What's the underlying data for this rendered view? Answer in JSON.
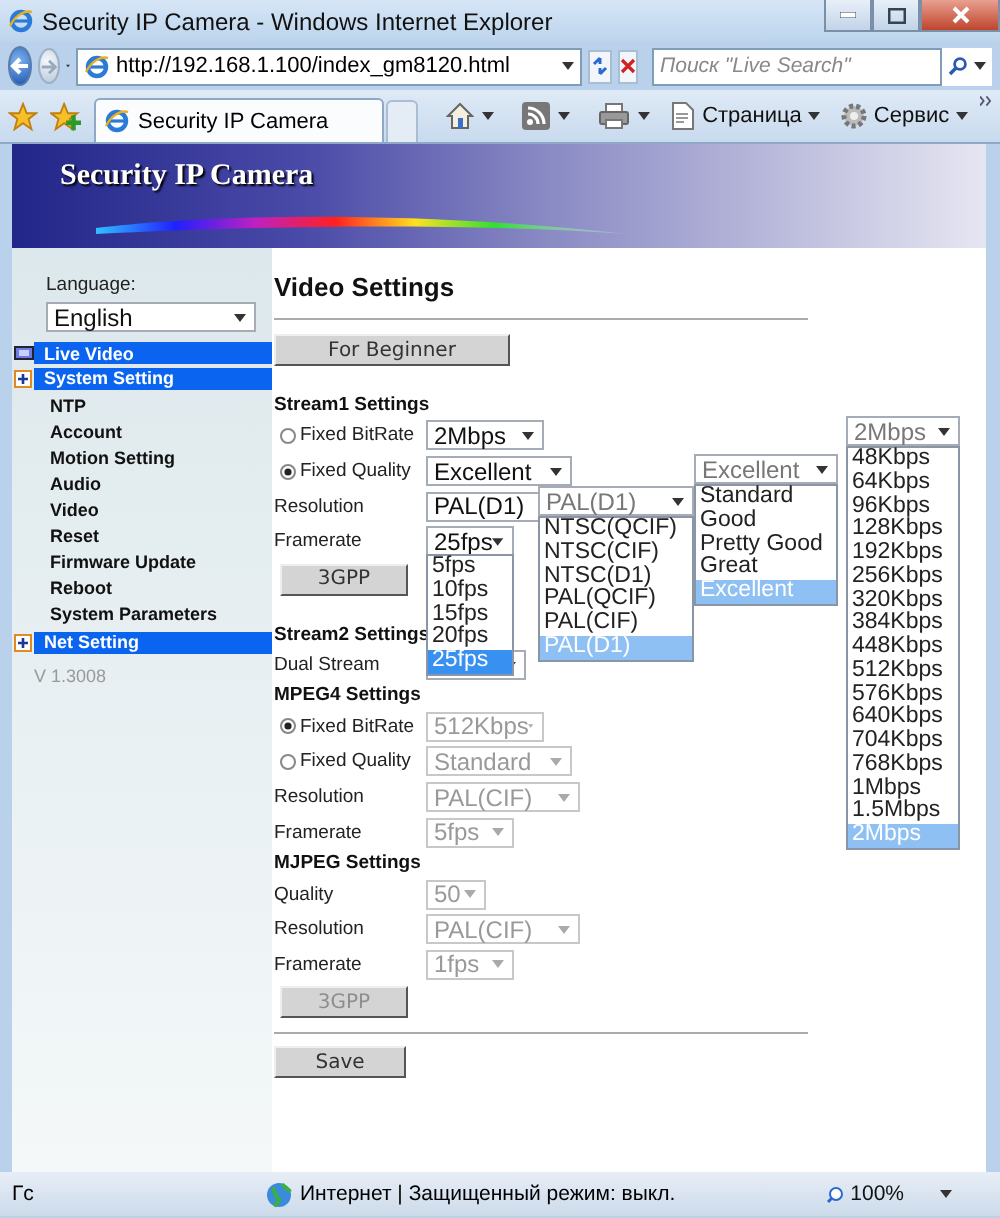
{
  "window": {
    "title": "Security IP Camera - Windows Internet Explorer"
  },
  "address_bar": {
    "url": "http://192.168.1.100/index_gm8120.html",
    "search_placeholder": "Поиск \"Live Search\""
  },
  "tabs": [
    {
      "label": "Security IP Camera",
      "selected": true
    }
  ],
  "toolbar": [
    {
      "label": "Страница",
      "kind": "page"
    },
    {
      "label": "Сервис",
      "kind": "tools"
    }
  ],
  "banner": {
    "title": "Security IP Camera"
  },
  "sidebar": {
    "language_label": "Language:",
    "language": "English",
    "items": [
      {
        "label": "Live Video",
        "kind": "video"
      },
      {
        "label": "System Setting",
        "kind": "group",
        "children": [
          {
            "label": "NTP"
          },
          {
            "label": "Account"
          },
          {
            "label": "Motion Setting"
          },
          {
            "label": "Audio"
          },
          {
            "label": "Video"
          },
          {
            "label": "Reset"
          },
          {
            "label": "Firmware Update"
          },
          {
            "label": "Reboot"
          },
          {
            "label": "System Parameters"
          }
        ]
      },
      {
        "label": "Net Setting",
        "kind": "group"
      }
    ],
    "version": "V 1.3008"
  },
  "main": {
    "title": "Video Settings",
    "beginner_button": "For Beginner",
    "sections": [
      {
        "title": "Stream1 Settings",
        "rows": [
          {
            "kind": "radio",
            "label": "Fixed BitRate",
            "checked": false,
            "value": "2Mbps",
            "disabled": false
          },
          {
            "kind": "radio",
            "label": "Fixed Quality",
            "checked": true,
            "value": "Excellent",
            "disabled": false
          },
          {
            "kind": "field",
            "label": "Resolution",
            "value": "PAL(D1)",
            "disabled": false
          },
          {
            "kind": "field",
            "label": "Framerate",
            "value": "25fps",
            "disabled": false
          }
        ],
        "button": {
          "label": "3GPP",
          "disabled": false
        }
      },
      {
        "title": "Stream2 Settings",
        "rows": [
          {
            "kind": "field",
            "label": "Dual Stream",
            "disabled": false
          }
        ]
      },
      {
        "title": "MPEG4 Settings",
        "rows": [
          {
            "kind": "radio",
            "label": "Fixed BitRate",
            "checked": true,
            "value": "512Kbps",
            "disabled": true
          },
          {
            "kind": "radio",
            "label": "Fixed Quality",
            "checked": false,
            "value": "Standard",
            "disabled": true
          },
          {
            "kind": "field",
            "label": "Resolution",
            "value": "PAL(CIF)",
            "disabled": true
          },
          {
            "kind": "field",
            "label": "Framerate",
            "value": "5fps",
            "disabled": true
          }
        ]
      },
      {
        "title": "MJPEG Settings",
        "rows": [
          {
            "kind": "field",
            "label": "Quality",
            "value": "50",
            "disabled": true
          },
          {
            "kind": "field",
            "label": "Resolution",
            "value": "PAL(CIF)",
            "disabled": true
          },
          {
            "kind": "field",
            "label": "Framerate",
            "value": "1fps",
            "disabled": true
          }
        ],
        "button": {
          "label": "3GPP",
          "disabled": true
        }
      }
    ],
    "save_button": "Save"
  },
  "dropdowns": [
    {
      "focused": true,
      "options": [
        {
          "label": "5fps",
          "selected": false
        },
        {
          "label": "10fps",
          "selected": false
        },
        {
          "label": "15fps",
          "selected": false
        },
        {
          "label": "20fps",
          "selected": false
        },
        {
          "label": "25fps",
          "selected": true
        }
      ]
    },
    {
      "focused": false,
      "value": "PAL(D1)",
      "options": [
        {
          "label": "NTSC(QCIF)",
          "selected": false
        },
        {
          "label": "NTSC(CIF)",
          "selected": false
        },
        {
          "label": "NTSC(D1)",
          "selected": false
        },
        {
          "label": "PAL(QCIF)",
          "selected": false
        },
        {
          "label": "PAL(CIF)",
          "selected": false
        },
        {
          "label": "PAL(D1)",
          "selected": true
        }
      ]
    },
    {
      "focused": false,
      "value": "Excellent",
      "options": [
        {
          "label": "Standard",
          "selected": false
        },
        {
          "label": "Good",
          "selected": false
        },
        {
          "label": "Pretty Good",
          "selected": false
        },
        {
          "label": "Great",
          "selected": false
        },
        {
          "label": "Excellent",
          "selected": true
        }
      ]
    },
    {
      "focused": false,
      "value": "2Mbps",
      "options": [
        {
          "label": "48Kbps",
          "selected": false
        },
        {
          "label": "64Kbps",
          "selected": false
        },
        {
          "label": "96Kbps",
          "selected": false
        },
        {
          "label": "128Kbps",
          "selected": false
        },
        {
          "label": "192Kbps",
          "selected": false
        },
        {
          "label": "256Kbps",
          "selected": false
        },
        {
          "label": "320Kbps",
          "selected": false
        },
        {
          "label": "384Kbps",
          "selected": false
        },
        {
          "label": "448Kbps",
          "selected": false
        },
        {
          "label": "512Kbps",
          "selected": false
        },
        {
          "label": "576Kbps",
          "selected": false
        },
        {
          "label": "640Kbps",
          "selected": false
        },
        {
          "label": "704Kbps",
          "selected": false
        },
        {
          "label": "768Kbps",
          "selected": false
        },
        {
          "label": "1Mbps",
          "selected": false
        },
        {
          "label": "1.5Mbps",
          "selected": false
        },
        {
          "label": "2Mbps",
          "selected": true
        }
      ]
    }
  ],
  "status_bar": {
    "left": "Гс",
    "zone": "Интернет | Защищенный режим: выкл.",
    "zoom": "100%"
  }
}
